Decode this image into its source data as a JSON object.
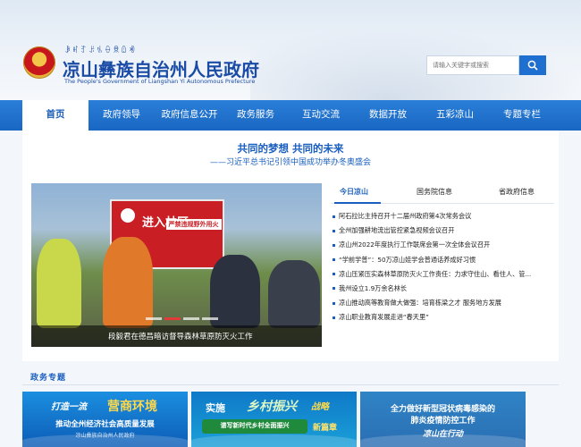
{
  "header": {
    "yi_script": "ꆃꎭꆈꌠꁱꂷꌋꅔꏓ",
    "title": "凉山彝族自治州人民政府",
    "subtitle": "The People's Government of Liangshan Yi Autonomous Prefecture",
    "search_placeholder": "请输入关键字或搜索",
    "search_icon": "search-icon"
  },
  "nav": {
    "items": [
      "首页",
      "政府领导",
      "政府信息公开",
      "政务服务",
      "互动交流",
      "数据开放",
      "五彩凉山",
      "专题专栏"
    ],
    "active_index": 0,
    "accent_color": "#1967c2"
  },
  "headline": {
    "title": "共同的梦想 共同的未来",
    "subtitle": "——习近平总书记引领中国成功举办冬奥盛会"
  },
  "slider": {
    "sign_text": "进入林区",
    "sign_text2": "严禁违规野外用火",
    "caption": "段毅君在德昌暗访督导森林草原防灭火工作",
    "active_dot": 1
  },
  "tabs": [
    "今日凉山",
    "国务院信息",
    "省政府信息"
  ],
  "news": [
    "阿石拉比主持召开十二届州政府第4次常务会议",
    "全州加强耕地流出管控紧急视频会议召开",
    "凉山州2022年度执行工作联席会第一次全体会议召开",
    "“学前学普”：50万凉山娃学会普通话养成好习惯",
    "凉山压紧压实森林草原防灭火工作责任：力求守住山、看住人、管...",
    "我州设立1.9万余名林长",
    "凉山推动高等教育做大做强：培育栋梁之才 服务地方发展",
    "凉山职业教育发展走进“春天里”"
  ],
  "section": {
    "title": "政务专题"
  },
  "cards": {
    "card1": {
      "a": "打造一流",
      "b": "营商环境",
      "c": "推动全州经济社会高质量发展",
      "d": "凉山彝族自治州人民政府"
    },
    "card2": {
      "a": "实施",
      "b": "乡村振兴",
      "c": "战略",
      "d": "谱写新时代乡村全面振兴",
      "e": "新篇章"
    },
    "card3": {
      "a": "全力做好新型冠状病毒感染的",
      "b": "肺炎疫情防控工作",
      "c": "凉山在行动"
    }
  }
}
